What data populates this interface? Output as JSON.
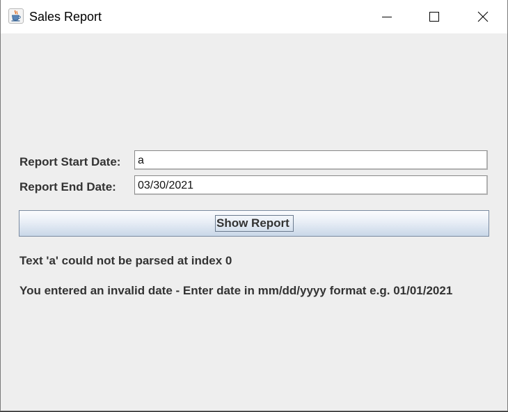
{
  "window": {
    "title": "Sales Report",
    "app_icon": "java-coffee-cup-icon",
    "controls": [
      "minimize-icon",
      "maximize-icon",
      "close-icon"
    ]
  },
  "form": {
    "start_label": "Report Start Date:",
    "start_value": "a",
    "end_label": "Report End Date:",
    "end_value": "03/30/2021",
    "show_button": "Show Report"
  },
  "messages": {
    "parse_error": "Text 'a' could not be parsed at index 0",
    "invalid_date": "You entered an invalid date - Enter date in mm/dd/yyyy format e.g. 01/01/2021"
  }
}
